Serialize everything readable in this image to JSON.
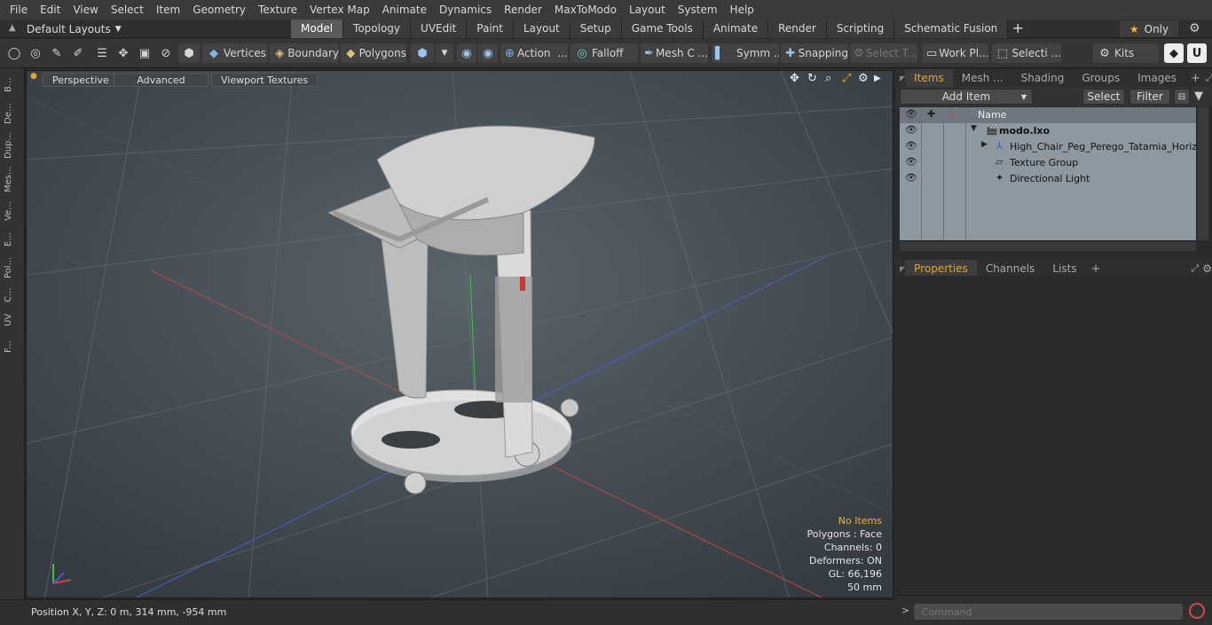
{
  "menu": [
    "File",
    "Edit",
    "View",
    "Select",
    "Item",
    "Geometry",
    "Texture",
    "Vertex Map",
    "Animate",
    "Dynamics",
    "Render",
    "MaxToModo",
    "Layout",
    "System",
    "Help"
  ],
  "layout_selector": "Default Layouts",
  "layout_tabs": [
    "Model",
    "Topology",
    "UVEdit",
    "Paint",
    "Layout",
    "Setup",
    "Game Tools",
    "Animate",
    "Render",
    "Scripting",
    "Schematic Fusion"
  ],
  "active_layout_tab": "Model",
  "only_button": "Only",
  "toolbar": {
    "vertices": "Vertices",
    "boundary": "Boundary",
    "polygons": "Polygons",
    "action": "Action",
    "falloff": "Falloff",
    "mesh_c": "Mesh C ...",
    "symm": "Symm ...",
    "snapping": "Snapping",
    "select_t": "Select T...",
    "work_pl": "Work Pl...",
    "selecti": "Selecti ...",
    "kits": "Kits"
  },
  "left_tools": [
    "B...",
    "De...",
    "Dup...",
    "Mes...",
    "Ve...",
    "E...",
    "Pol...",
    "C...",
    "UV",
    "F..."
  ],
  "viewport": {
    "tabs": [
      "Perspective",
      "Advanced",
      "Viewport Textures"
    ],
    "info": {
      "selection": "No Items",
      "polygons": "Polygons : Face",
      "channels": "Channels: 0",
      "deformers": "Deformers: ON",
      "gl": "GL: 66,196",
      "scale": "50 mm"
    }
  },
  "status": "Position X, Y, Z:   0 m, 314 mm, -954 mm",
  "items_panel": {
    "tabs": [
      "Items",
      "Mesh ...",
      "Shading",
      "Groups",
      "Images"
    ],
    "active_tab": "Items",
    "add_item": "Add Item",
    "select": "Select",
    "filter": "Filter",
    "name_header": "Name",
    "rows": [
      {
        "label": "modo.lxo"
      },
      {
        "label": "High_Chair_Peg_Perego_Tatamia_Horiz ..."
      },
      {
        "label": "Texture Group"
      },
      {
        "label": "Directional Light"
      }
    ]
  },
  "props_panel": {
    "tabs": [
      "Properties",
      "Channels",
      "Lists"
    ],
    "active_tab": "Properties"
  },
  "command": {
    "placeholder": "Command"
  },
  "colors": {
    "accent": "#e8a32e",
    "viewport_bg": "#4a5358",
    "item_list_bg": "#8e98a1"
  }
}
